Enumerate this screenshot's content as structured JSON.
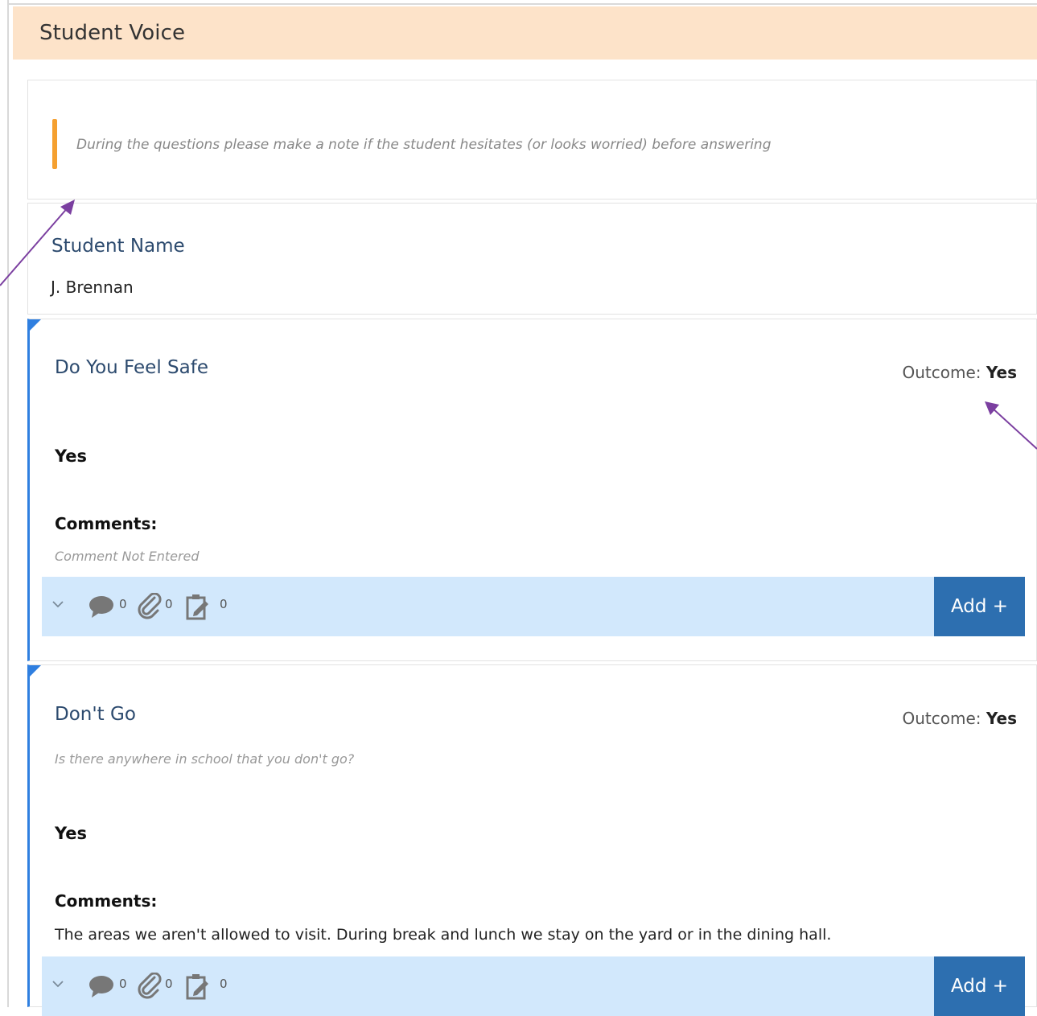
{
  "section": {
    "title": "Student Voice"
  },
  "note": {
    "text": "During the questions please make a note if the student hesitates (or looks worried) before answering"
  },
  "student": {
    "label": "Student Name",
    "value": "J. Brennan"
  },
  "questions": [
    {
      "title": "Do You Feel Safe",
      "subtitle": "",
      "outcome_label": "Outcome:",
      "outcome_value": "Yes",
      "answer": "Yes",
      "comments_label": "Comments:",
      "comment": "Comment Not Entered",
      "counts": {
        "comments": "0",
        "attachments": "0",
        "tasks": "0"
      },
      "add_label": "Add +"
    },
    {
      "title": "Don't Go",
      "subtitle": "Is there anywhere in school that you don't go?",
      "outcome_label": "Outcome:",
      "outcome_value": "Yes",
      "answer": "Yes",
      "comments_label": "Comments:",
      "comment": "The areas we aren't allowed to visit. During break and lunch we stay on the yard or in the dining hall.",
      "counts": {
        "comments": "0",
        "attachments": "0",
        "tasks": "0"
      },
      "add_label": "Add +"
    }
  ],
  "icons": {
    "chevron": "chevron-down-icon",
    "comments": "speech-bubble-icon",
    "attachments": "paperclip-icon",
    "tasks": "clipboard-edit-icon"
  },
  "colors": {
    "header_bg": "#fde3c9",
    "accent_orange": "#f5a030",
    "accent_blue": "#2f7fe0",
    "toolbar_bg": "#d2e8fc",
    "button_bg": "#2d6fb0",
    "annotation_arrow": "#7b3fa0"
  }
}
